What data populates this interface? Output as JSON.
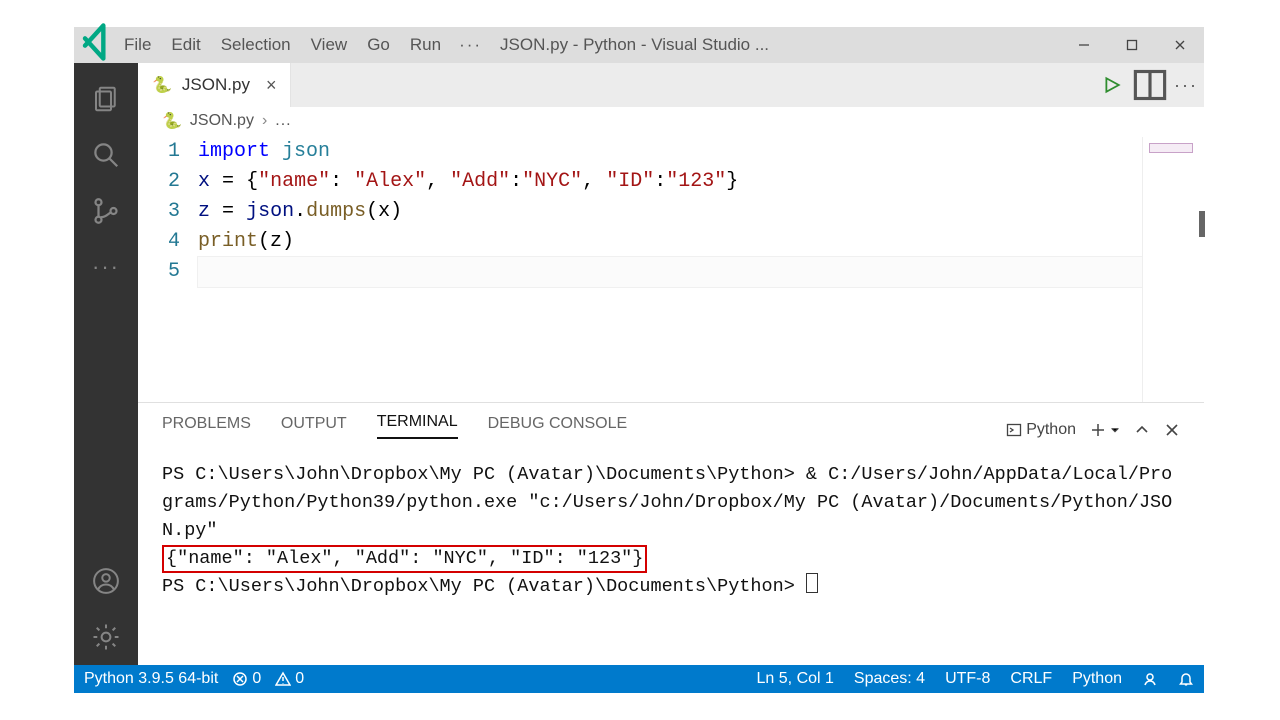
{
  "window": {
    "title": "JSON.py - Python - Visual Studio ..."
  },
  "menu": {
    "file": "File",
    "edit": "Edit",
    "selection": "Selection",
    "view": "View",
    "go": "Go",
    "run": "Run"
  },
  "tab": {
    "filename": "JSON.py"
  },
  "breadcrumb": {
    "file": "JSON.py",
    "rest": "..."
  },
  "editor": {
    "line_numbers": [
      "1",
      "2",
      "3",
      "4",
      "5"
    ],
    "lines": {
      "l1": {
        "kw": "import",
        "mod": "json"
      },
      "l2": {
        "lhs": "x",
        "eq": "=",
        "open": "{",
        "k1": "\"name\"",
        "c1": ": ",
        "v1": "\"Alex\"",
        "s1": ", ",
        "k2": "\"Add\"",
        "c2": ":",
        "v2": "\"NYC\"",
        "s2": ", ",
        "k3": "\"ID\"",
        "c3": ":",
        "v3": "\"123\"",
        "close": "}"
      },
      "l3": {
        "lhs": "z",
        "eq": "=",
        "mod": "json",
        "dot": ".",
        "fn": "dumps",
        "args": "(x)"
      },
      "l4": {
        "fn": "print",
        "args": "(z)"
      }
    }
  },
  "panel": {
    "tabs": {
      "problems": "PROBLEMS",
      "output": "OUTPUT",
      "terminal": "TERMINAL",
      "debug": "DEBUG CONSOLE"
    },
    "shell_label": "Python"
  },
  "terminal": {
    "line1": "PS C:\\Users\\John\\Dropbox\\My PC (Avatar)\\Documents\\Python> & C:/Users/John/AppData/Local/Programs/Python/Python39/python.exe \"c:/Users/John/Dropbox/My PC (Avatar)/Documents/Python/JSON.py\"",
    "output": "{\"name\": \"Alex\", \"Add\": \"NYC\", \"ID\": \"123\"}",
    "prompt2": "PS C:\\Users\\John\\Dropbox\\My PC (Avatar)\\Documents\\Python> "
  },
  "status": {
    "interpreter": "Python 3.9.5 64-bit",
    "errors": "0",
    "warnings": "0",
    "cursor": "Ln 5, Col 1",
    "spaces": "Spaces: 4",
    "encoding": "UTF-8",
    "eol": "CRLF",
    "lang": "Python"
  }
}
